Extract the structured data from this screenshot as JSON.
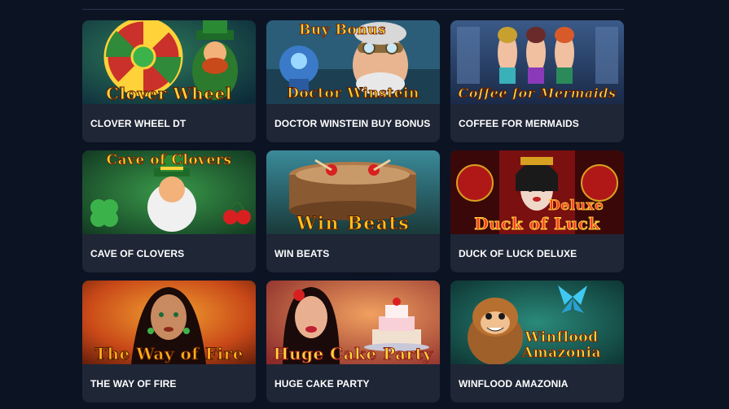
{
  "games": [
    {
      "title": "CLOVER WHEEL DT",
      "logo": "Clover Wheel",
      "logo_color": "#ffd23a"
    },
    {
      "title": "DOCTOR WINSTEIN BUY BONUS",
      "logo": "Doctor Winstein",
      "logo_top": "Buy Bonus",
      "logo_color": "#ffcf2e"
    },
    {
      "title": "COFFEE FOR MERMAIDS",
      "logo": "Coffee for Mermaids",
      "logo_color": "#ffd54a"
    },
    {
      "title": "CAVE OF CLOVERS",
      "logo": "Cave of Clovers",
      "logo_color": "#ffcc2a"
    },
    {
      "title": "WIN BEATS",
      "logo": "Win Beats",
      "logo_color": "#ffc21f"
    },
    {
      "title": "DUCK OF LUCK DELUXE",
      "logo": "Duck of Luck",
      "logo_top": "Deluxe",
      "logo_color": "#ff3a2a"
    },
    {
      "title": "THE WAY OF FIRE",
      "logo": "The Way of Fire",
      "logo_color": "#ffb21f"
    },
    {
      "title": "HUGE CAKE PARTY",
      "logo": "Huge Cake Party",
      "logo_color": "#ffd83a"
    },
    {
      "title": "WINFLOOD AMAZONIA",
      "logo": "Winflood Amazonia",
      "logo_color": "#ffd23a"
    }
  ],
  "colors": {
    "background": "#0c1424",
    "card": "#1f2636",
    "title_text": "#ffffff"
  }
}
